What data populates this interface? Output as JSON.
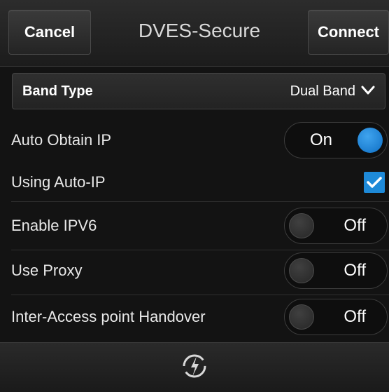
{
  "header": {
    "cancel_label": "Cancel",
    "title": "DVES-Secure",
    "connect_label": "Connect"
  },
  "band": {
    "label": "Band Type",
    "value": "Dual Band",
    "icon": "chevron-down-icon"
  },
  "settings": [
    {
      "label": "Auto Obtain IP",
      "control": "toggle",
      "state": "On",
      "checked": true
    },
    {
      "label": "Using Auto-IP",
      "control": "checkbox",
      "checked": true
    },
    {
      "label": "Enable IPV6",
      "control": "toggle",
      "state": "Off",
      "checked": false
    },
    {
      "label": "Use Proxy",
      "control": "toggle",
      "state": "Off",
      "checked": false
    },
    {
      "label": "Inter-Access point Handover",
      "control": "toggle",
      "state": "Off",
      "checked": false
    }
  ],
  "footer": {
    "icon": "refresh-icon"
  },
  "colors": {
    "accent": "#1e8ad8",
    "background": "#131313"
  }
}
